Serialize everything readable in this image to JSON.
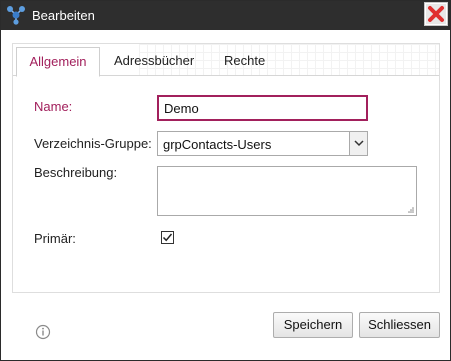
{
  "window": {
    "title": "Bearbeiten",
    "app_icon": "contacts-network-icon",
    "close_icon": "close-icon"
  },
  "tabs": [
    {
      "label": "Allgemein",
      "active": true
    },
    {
      "label": "Adressbücher",
      "active": false
    },
    {
      "label": "Rechte",
      "active": false
    }
  ],
  "form": {
    "name_label": "Name:",
    "name_value": "Demo",
    "group_label": "Verzeichnis-Gruppe:",
    "group_value": "grpContacts-Users",
    "description_label": "Beschreibung:",
    "description_value": "",
    "primary_label": "Primär:",
    "primary_checked": true
  },
  "footer": {
    "info_icon": "info-icon",
    "save_label": "Speichern",
    "close_label": "Schliessen"
  },
  "colors": {
    "accent": "#a2205c",
    "titlebar": "#2e2e2e",
    "close_button": "#e03030"
  }
}
